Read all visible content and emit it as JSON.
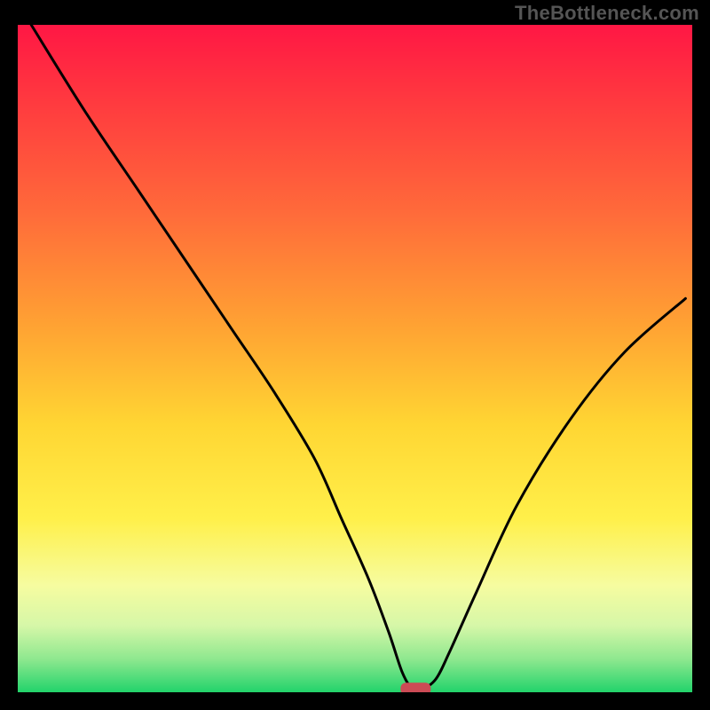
{
  "watermark": "TheBottleneck.com",
  "chart_data": {
    "type": "line",
    "title": "",
    "xlabel": "",
    "ylabel": "",
    "xlim": [
      0,
      100
    ],
    "ylim": [
      0,
      100
    ],
    "grid": false,
    "legend": false,
    "gradient_stops": [
      {
        "offset": 0.0,
        "color": "#ff1744"
      },
      {
        "offset": 0.12,
        "color": "#ff3b3f"
      },
      {
        "offset": 0.28,
        "color": "#ff6a3a"
      },
      {
        "offset": 0.45,
        "color": "#ffa233"
      },
      {
        "offset": 0.6,
        "color": "#ffd633"
      },
      {
        "offset": 0.74,
        "color": "#fff04a"
      },
      {
        "offset": 0.84,
        "color": "#f6fca0"
      },
      {
        "offset": 0.9,
        "color": "#d6f7a8"
      },
      {
        "offset": 0.95,
        "color": "#8fe88f"
      },
      {
        "offset": 1.0,
        "color": "#22d36b"
      }
    ],
    "series": [
      {
        "name": "bottleneck-curve",
        "x": [
          2,
          10,
          18,
          26,
          32,
          38,
          44,
          48,
          52,
          55,
          57,
          58.5,
          60,
          62,
          64,
          68,
          74,
          82,
          90,
          99
        ],
        "y": [
          100,
          87,
          75,
          63,
          54,
          45,
          35,
          26,
          17,
          9,
          3,
          0.5,
          0.5,
          2,
          6,
          15,
          28,
          41,
          51,
          59
        ]
      }
    ],
    "annotations": [
      {
        "name": "optimal-marker",
        "shape": "rounded-rect",
        "x": 59,
        "y": 0.5,
        "color": "#cc4b55"
      }
    ]
  }
}
